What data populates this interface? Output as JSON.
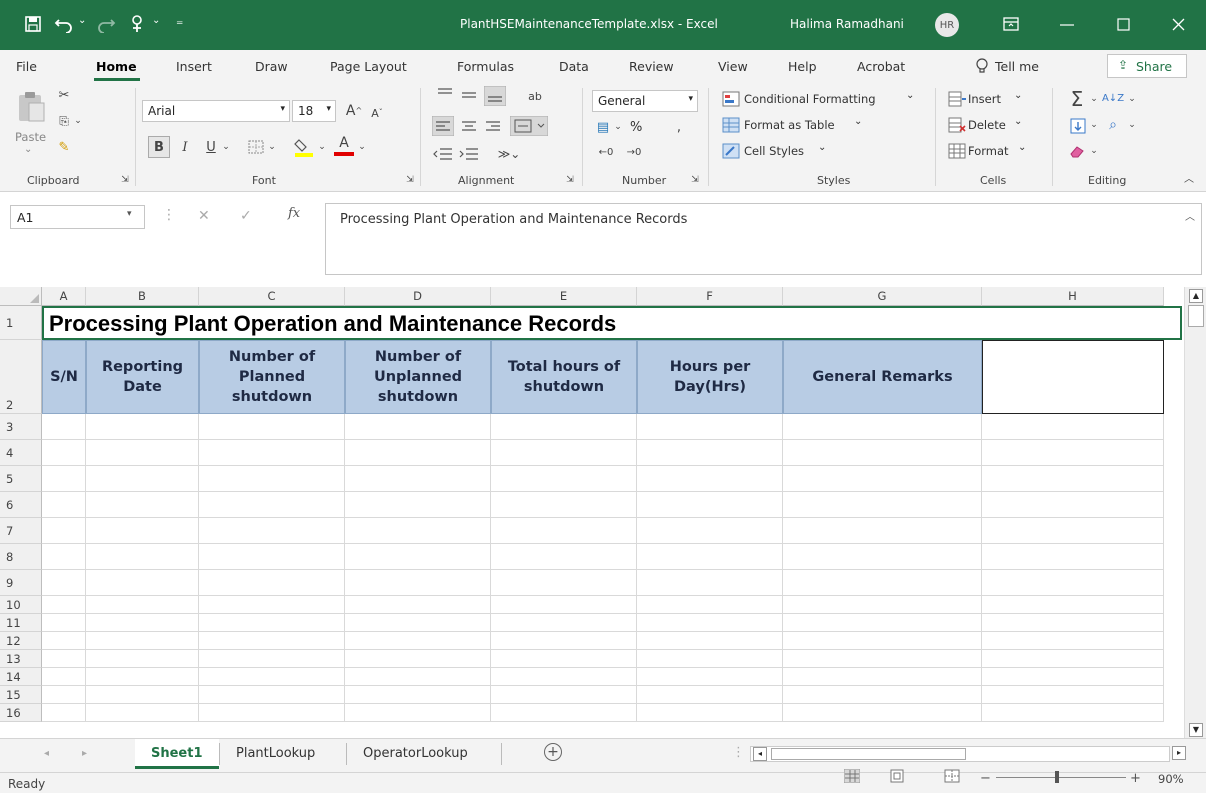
{
  "titlebar": {
    "file_name": "PlantHSEMaintenanceTemplate.xlsx - Excel",
    "user_name": "Halima Ramadhani",
    "user_initials": "HR"
  },
  "tabs": [
    "File",
    "Home",
    "Insert",
    "Draw",
    "Page Layout",
    "Formulas",
    "Data",
    "Review",
    "View",
    "Help",
    "Acrobat"
  ],
  "tell_me": "Tell me",
  "share_label": "Share",
  "ribbon": {
    "paste": "Paste",
    "font_name": "Arial",
    "font_size": "18",
    "number_format": "General",
    "percent": "%",
    "conditional_formatting": "Conditional Formatting",
    "format_as_table": "Format as Table",
    "cell_styles": "Cell Styles",
    "insert": "Insert",
    "delete": "Delete",
    "format": "Format",
    "groups": {
      "clipboard": "Clipboard",
      "font": "Font",
      "alignment": "Alignment",
      "number": "Number",
      "styles": "Styles",
      "cells": "Cells",
      "editing": "Editing"
    }
  },
  "formula_bar": {
    "name_box": "A1",
    "fx": "fx",
    "content": "Processing Plant Operation and Maintenance Records"
  },
  "sheet": {
    "columns": [
      "A",
      "B",
      "C",
      "D",
      "E",
      "F",
      "G",
      "H"
    ],
    "title": "Processing Plant Operation and Maintenance Records",
    "headers": [
      "S/N",
      "Reporting Date",
      "Number of Planned shutdown",
      "Number of Unplanned shutdown",
      "Total hours of shutdown",
      "Hours per Day(Hrs)",
      "General Remarks",
      ""
    ],
    "row_numbers": [
      "1",
      "2",
      "3",
      "4",
      "5",
      "6",
      "7",
      "8",
      "9",
      "10",
      "11",
      "12",
      "13",
      "14",
      "15",
      "16"
    ]
  },
  "sheet_tabs": [
    "Sheet1",
    "PlantLookup",
    "OperatorLookup"
  ],
  "active_sheet": "Sheet1",
  "status": {
    "ready": "Ready",
    "zoom": "90%"
  },
  "colors": {
    "accent": "#217346",
    "header_fill": "#b8cce4"
  }
}
